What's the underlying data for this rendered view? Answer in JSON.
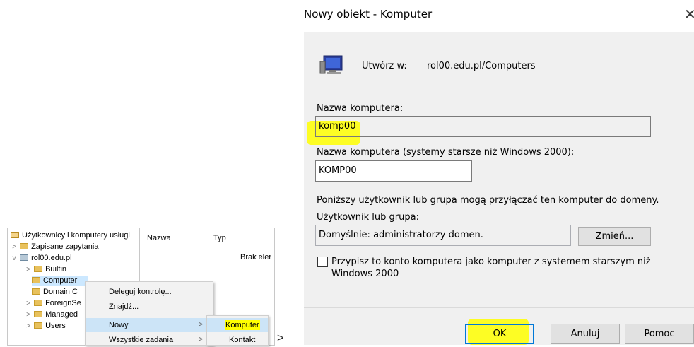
{
  "tree": {
    "root_label": "Użytkownicy i komputery usługi",
    "items": [
      {
        "label": "Zapisane zapytania"
      },
      {
        "label": "rol00.edu.pl"
      },
      {
        "label": "Builtin"
      },
      {
        "label": "Computer"
      },
      {
        "label": "Domain C"
      },
      {
        "label": "ForeignSe"
      },
      {
        "label": "Managed"
      },
      {
        "label": "Users"
      }
    ]
  },
  "list": {
    "columns": [
      "Nazwa",
      "Typ"
    ],
    "empty_text": "Brak eler"
  },
  "context_menu": {
    "items": [
      {
        "label": "Deleguj kontrolę..."
      },
      {
        "label": "Znajdź..."
      },
      {
        "label": "Nowy",
        "arrow": ">"
      },
      {
        "label": "Wszystkie zadania",
        "arrow": ">"
      }
    ],
    "submenu": [
      {
        "label": "Komputer"
      },
      {
        "label": "Kontakt"
      }
    ]
  },
  "separator_glyph": ">",
  "dialog": {
    "title": "Nowy obiekt - Komputer",
    "close_glyph": "✕",
    "create_in_label": "Utwórz w:",
    "create_in_value": "rol00.edu.pl/Computers",
    "computer_name_label": "Nazwa komputera:",
    "computer_name_value": "komp00",
    "legacy_name_label": "Nazwa komputera (systemy starsze niż Windows 2000):",
    "legacy_name_value": "KOMP00",
    "join_info": "Poniższy użytkownik lub grupa mogą przyłączać ten komputer do domeny.",
    "user_group_label": "Użytkownik lub grupa:",
    "user_group_value": "Domyślnie: administratorzy domen.",
    "change_button": "Zmień...",
    "legacy_checkbox_line1": "Przypisz to konto komputera jako komputer z systemem starszym niż",
    "legacy_checkbox_line2": "Windows 2000",
    "legacy_checkbox_checked": false,
    "buttons": {
      "ok": "OK",
      "cancel": "Anuluj",
      "help": "Pomoc"
    }
  },
  "colors": {
    "highlight": "#ffff00",
    "selection": "#cce8ff",
    "default_button_border": "#0078d7"
  }
}
